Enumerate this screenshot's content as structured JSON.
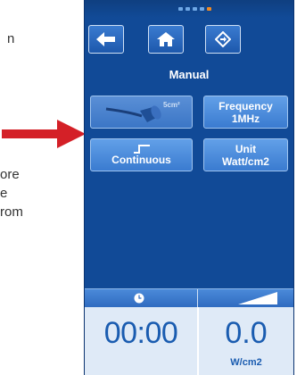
{
  "manual_text": {
    "fragment_1": "n",
    "fragment_2": "ore",
    "fragment_3": "e",
    "fragment_4": "rom"
  },
  "device": {
    "title": "Manual",
    "tiles": {
      "head_label": "5cm²",
      "frequency_label": "Frequency",
      "frequency_value": "1MHz",
      "mode_label": "Continuous",
      "unit_label": "Unit",
      "unit_value": "Watt/cm2"
    },
    "display": {
      "time": "00:00",
      "intensity": "0.0",
      "intensity_unit": "W/cm2"
    }
  },
  "colors": {
    "device_bg": "#114a97",
    "tile_bg": "#4f8fe0",
    "callout_arrow": "#d42027",
    "progress_active": "#f08a24"
  }
}
